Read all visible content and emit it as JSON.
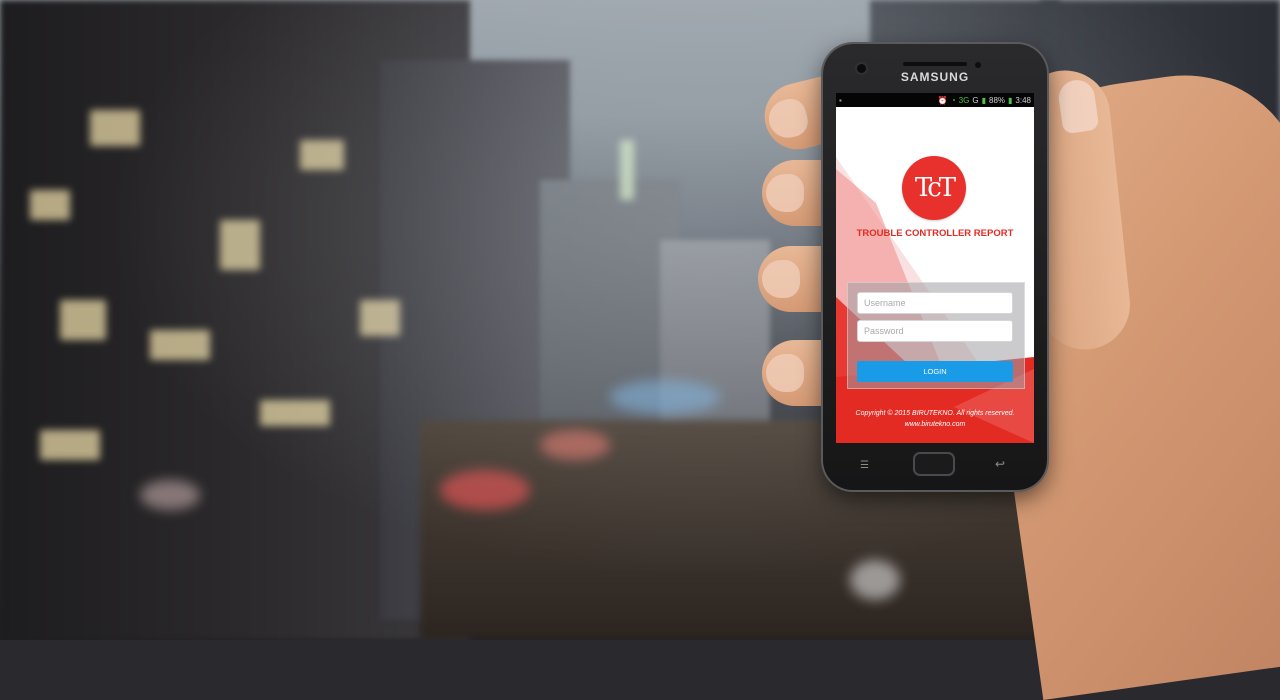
{
  "device": {
    "brand": "SAMSUNG"
  },
  "status_bar": {
    "left_icon": "notification-icon",
    "alarm_icon": "alarm-icon",
    "wifi_icon": "wifi-icon",
    "network_3g": "3G",
    "network_g": "G",
    "battery": "88%",
    "time": "3:48"
  },
  "app": {
    "logo_text": "TcT",
    "title": "TROUBLE CONTROLLER REPORT",
    "username_placeholder": "Username",
    "password_placeholder": "Password",
    "login_label": "LOGIN",
    "copyright": "Copyright © 2015 BIRUTEKNO. All rights reserved.",
    "website": "www.birutekno.com"
  },
  "colors": {
    "accent_red": "#e32b24",
    "button_blue": "#1a9be8"
  }
}
